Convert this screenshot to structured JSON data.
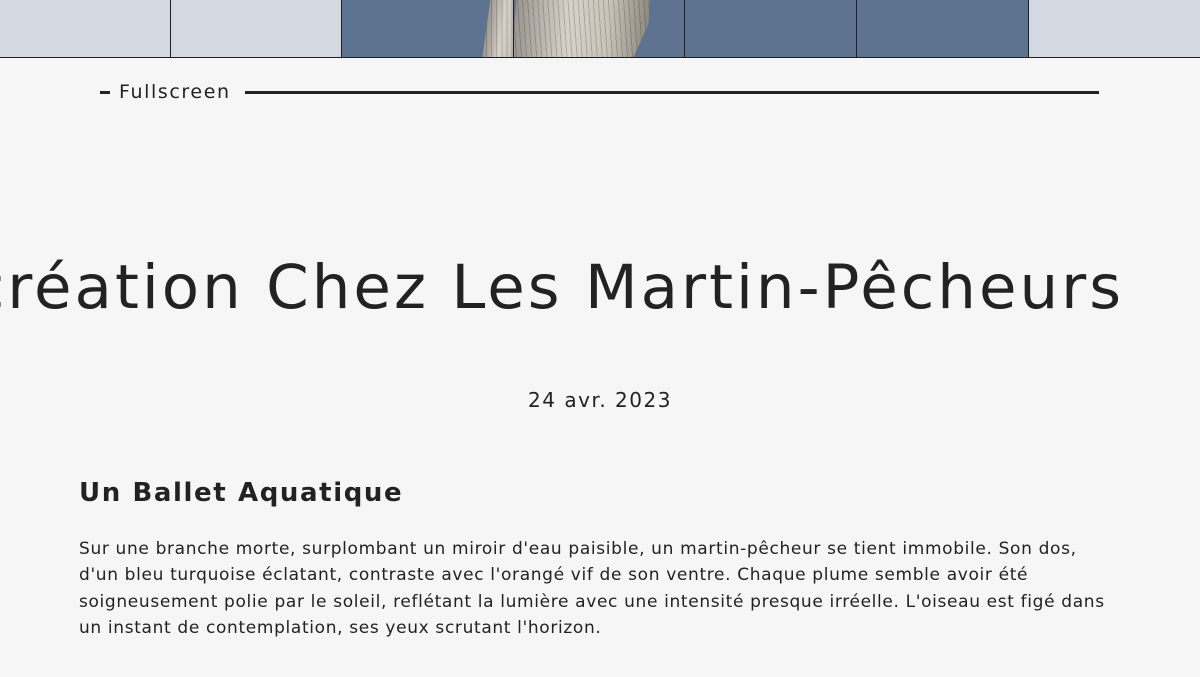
{
  "gallery": {
    "thumbnails": [
      {
        "name": "thumbnail-1",
        "state": "faded"
      },
      {
        "name": "thumbnail-2",
        "state": "faded"
      },
      {
        "name": "thumbnail-3",
        "state": "active"
      },
      {
        "name": "thumbnail-4",
        "state": "active"
      },
      {
        "name": "thumbnail-5",
        "state": "active"
      },
      {
        "name": "thumbnail-6",
        "state": "active"
      },
      {
        "name": "thumbnail-7",
        "state": "faded"
      }
    ],
    "colors": {
      "faded": "#d3d9e1",
      "active": "#5d7390"
    }
  },
  "fullscreen": {
    "label": "Fullscreen"
  },
  "post": {
    "title": "Récréation Chez Les Martin-Pêcheurs",
    "date": "24 avr. 2023",
    "section": {
      "heading": "Un Ballet Aquatique",
      "body": "Sur une branche morte, surplombant un miroir d'eau paisible, un martin-pêcheur se tient immobile. Son dos, d'un bleu turquoise éclatant, contraste avec l'orangé vif de son ventre. Chaque plume semble avoir été soigneusement polie par le soleil, reflétant la lumière avec une intensité presque irréelle. L'oiseau est figé dans un instant de contemplation, ses yeux scrutant l'horizon."
    }
  },
  "colors": {
    "background": "#f6f6f6",
    "text": "#222222"
  }
}
